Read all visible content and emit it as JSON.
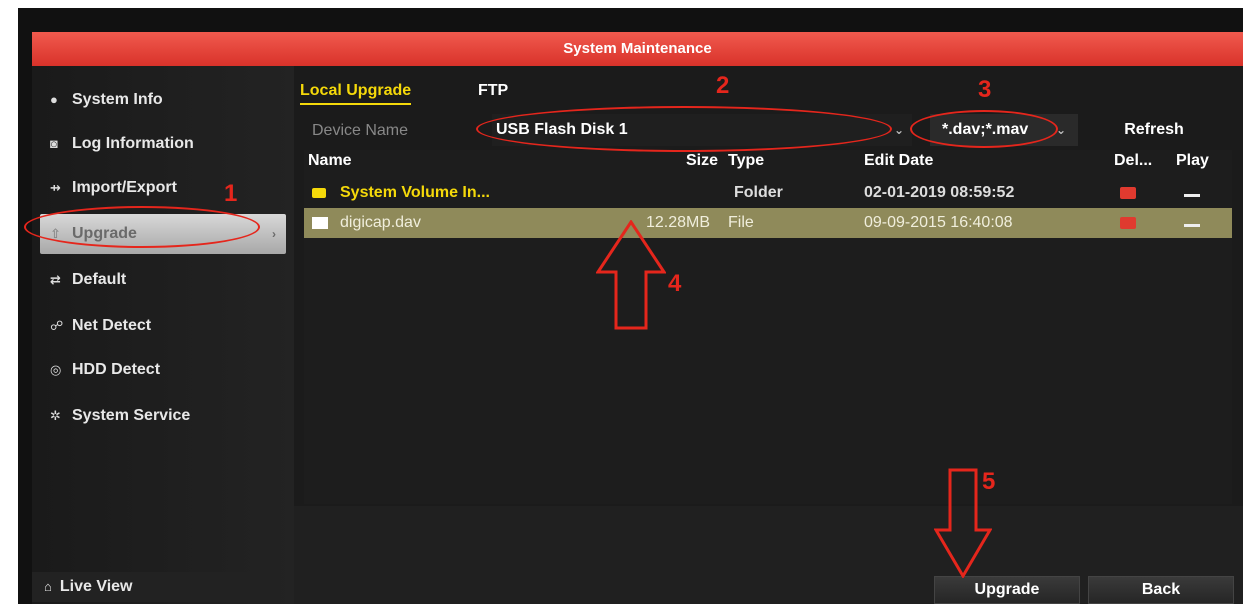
{
  "window": {
    "title": "System Maintenance"
  },
  "sidebar": {
    "items": [
      {
        "label": "System Info",
        "icon": "info-icon"
      },
      {
        "label": "Log Information",
        "icon": "log-icon"
      },
      {
        "label": "Import/Export",
        "icon": "import-export-icon"
      },
      {
        "label": "Upgrade",
        "icon": "upgrade-icon",
        "active": true
      },
      {
        "label": "Default",
        "icon": "default-icon"
      },
      {
        "label": "Net Detect",
        "icon": "network-icon"
      },
      {
        "label": "HDD Detect",
        "icon": "hdd-icon"
      },
      {
        "label": "System Service",
        "icon": "service-gear-icon"
      }
    ],
    "live_view_label": "Live View"
  },
  "tabs": [
    {
      "label": "Local Upgrade",
      "active": true
    },
    {
      "label": "FTP",
      "active": false
    }
  ],
  "device": {
    "label": "Device Name",
    "value": "USB Flash Disk 1",
    "filter": "*.dav;*.mav",
    "refresh_label": "Refresh"
  },
  "table": {
    "headers": [
      "Name",
      "Size",
      "Type",
      "Edit Date",
      "Del...",
      "Play"
    ],
    "rows": [
      {
        "name": "System Volume In...",
        "size": "",
        "type": "Folder",
        "date": "02-01-2019 08:59:52"
      },
      {
        "name": "digicap.dav",
        "size": "12.28MB",
        "type": "File",
        "date": "09-09-2015 16:40:08",
        "selected": true
      }
    ]
  },
  "buttons": {
    "upgrade": "Upgrade",
    "back": "Back"
  },
  "annotations": [
    "1",
    "2",
    "3",
    "4",
    "5"
  ],
  "colors": {
    "accent": "#f5d90a",
    "titlebar": "#e03a2f",
    "annotation": "#e5261c",
    "selected_row": "#8f8a5a"
  }
}
